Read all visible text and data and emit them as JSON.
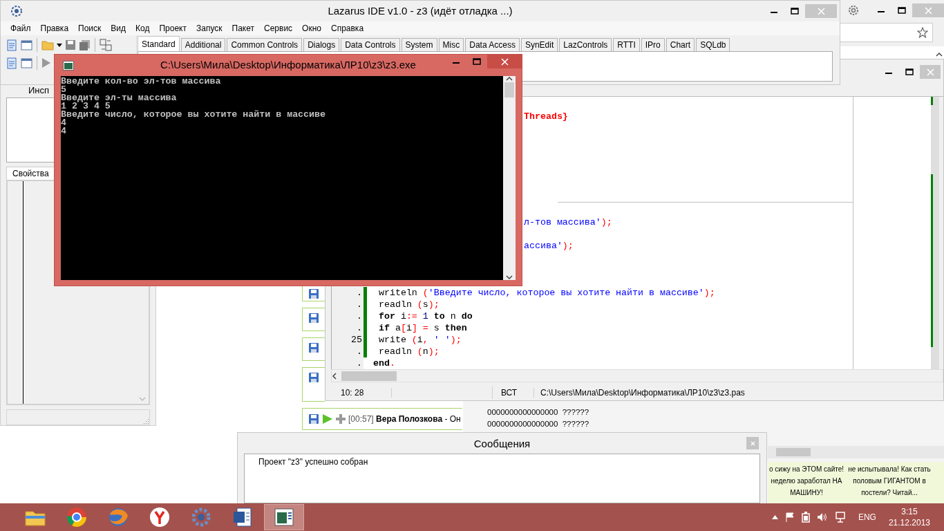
{
  "main_window": {
    "title": "Lazarus IDE v1.0 - z3 (идёт отладка ...)",
    "menu": [
      "Файл",
      "Правка",
      "Поиск",
      "Вид",
      "Код",
      "Проект",
      "Запуск",
      "Пакет",
      "Сервис",
      "Окно",
      "Справка"
    ],
    "palette_tabs": [
      {
        "label": "Standard",
        "selected": true
      },
      {
        "label": "Additional",
        "selected": false
      },
      {
        "label": "Common Controls",
        "selected": false
      },
      {
        "label": "Dialogs",
        "selected": false
      },
      {
        "label": "Data Controls",
        "selected": false
      },
      {
        "label": "System",
        "selected": false
      },
      {
        "label": "Misc",
        "selected": false
      },
      {
        "label": "Data Access",
        "selected": false
      },
      {
        "label": "SynEdit",
        "selected": false
      },
      {
        "label": "LazControls",
        "selected": false
      },
      {
        "label": "RTTI",
        "selected": false
      },
      {
        "label": "IPro",
        "selected": false
      },
      {
        "label": "Chart",
        "selected": false
      },
      {
        "label": "SQLdb",
        "selected": false
      }
    ]
  },
  "object_inspector": {
    "title": "Инсп",
    "tabs": [
      {
        "label": "Свойства",
        "selected": true
      }
    ]
  },
  "source_editor": {
    "lines": [
      {
        "kind": "clipped",
        "tokens": [
          {
            "text": "Threads}",
            "kind": "dir"
          }
        ]
      },
      {
        "kind": "covered"
      },
      {
        "kind": "covered"
      },
      {
        "kind": "covered"
      },
      {
        "kind": "covered"
      },
      {
        "kind": "covered"
      },
      {
        "kind": "covered"
      },
      {
        "kind": "covered"
      },
      {
        "kind": "covered"
      },
      {
        "kind": "clipped",
        "tokens": [
          {
            "text": "л-тов массива'",
            "kind": "str"
          },
          {
            "text": ");",
            "kind": "sym"
          }
        ]
      },
      {
        "kind": "covered"
      },
      {
        "kind": "clipped",
        "tokens": [
          {
            "text": "ассива'",
            "kind": "str"
          },
          {
            "text": ");",
            "kind": "sym"
          }
        ]
      },
      {
        "kind": "covered"
      },
      {
        "kind": "covered"
      },
      {
        "kind": "covered"
      },
      {
        "kind": "full",
        "gutter": ".",
        "modified": true,
        "tokens": [
          {
            "text": " writeln ",
            "kind": "id"
          },
          {
            "text": "(",
            "kind": "sym"
          },
          {
            "text": "'Введите число, которое вы хотите найти в массиве'",
            "kind": "str"
          },
          {
            "text": ");",
            "kind": "sym"
          }
        ]
      },
      {
        "kind": "full",
        "gutter": ".",
        "modified": true,
        "tokens": [
          {
            "text": " readln ",
            "kind": "id"
          },
          {
            "text": "(",
            "kind": "sym"
          },
          {
            "text": "s",
            "kind": "id"
          },
          {
            "text": ");",
            "kind": "sym"
          }
        ]
      },
      {
        "kind": "full",
        "gutter": ".",
        "modified": true,
        "tokens": [
          {
            "text": " for",
            "kind": "kw"
          },
          {
            "text": " i",
            "kind": "id"
          },
          {
            "text": ":=",
            "kind": "sym"
          },
          {
            "text": " 1",
            "kind": "num"
          },
          {
            "text": " to",
            "kind": "kw"
          },
          {
            "text": " n",
            "kind": "id"
          },
          {
            "text": " do",
            "kind": "kw"
          }
        ]
      },
      {
        "kind": "full",
        "gutter": ".",
        "modified": true,
        "tokens": [
          {
            "text": " if",
            "kind": "kw"
          },
          {
            "text": " a",
            "kind": "id"
          },
          {
            "text": "[",
            "kind": "sym"
          },
          {
            "text": "i",
            "kind": "id"
          },
          {
            "text": "]",
            "kind": "sym"
          },
          {
            "text": " =",
            "kind": "sym"
          },
          {
            "text": " s",
            "kind": "id"
          },
          {
            "text": " then",
            "kind": "kw"
          }
        ]
      },
      {
        "kind": "full",
        "gutter": "25",
        "modified": true,
        "tokens": [
          {
            "text": " write ",
            "kind": "id"
          },
          {
            "text": "(",
            "kind": "sym"
          },
          {
            "text": "i",
            "kind": "id"
          },
          {
            "text": ", ",
            "kind": "sym"
          },
          {
            "text": "' '",
            "kind": "str"
          },
          {
            "text": ");",
            "kind": "sym"
          }
        ]
      },
      {
        "kind": "full",
        "gutter": ".",
        "modified": true,
        "tokens": [
          {
            "text": " readln ",
            "kind": "id"
          },
          {
            "text": "(",
            "kind": "sym"
          },
          {
            "text": "n",
            "kind": "id"
          },
          {
            "text": ");",
            "kind": "sym"
          }
        ]
      },
      {
        "kind": "full",
        "gutter": ".",
        "modified": false,
        "tokens": [
          {
            "text": "end",
            "kind": "kw"
          },
          {
            "text": ".",
            "kind": "sym"
          }
        ]
      }
    ],
    "status_bar": {
      "position": "10: 28",
      "mode": "ВСТ",
      "file": "C:\\Users\\Мила\\Desktop\\Информатика\\ЛР10\\z3\\z3.pas"
    }
  },
  "console": {
    "title": "C:\\Users\\Мила\\Desktop\\Информатика\\ЛР10\\z3\\z3.exe",
    "lines": [
      "Введите кол-во эл-тов массива",
      "5",
      "Введите эл-ты массива",
      "1 2 3 4 5",
      "Введите число, которое вы хотите найти в массиве",
      "4",
      "4"
    ]
  },
  "background_page": {
    "track": {
      "time": "[00:57]",
      "artist": "Вера Полозкова",
      "title": "- Он"
    },
    "text_lines": [
      "0000000000000000  ??????",
      "0000000000000000  ??????"
    ],
    "ads": [
      "о сижу на ЭТОМ сайте! неделю заработал НА МАШИНУ!",
      "не испытывала! Как стать половым ГИГАНТОМ в постели? Читай..."
    ]
  },
  "messages": {
    "title": "Сообщения",
    "items": [
      "Проект \"z3\" успешно собран"
    ]
  },
  "taskbar": {
    "apps": [
      {
        "kind": "folder",
        "selected": false
      },
      {
        "kind": "ring",
        "selected": false
      },
      {
        "kind": "globe",
        "selected": false
      },
      {
        "kind": "yletter",
        "selected": false
      },
      {
        "kind": "gear",
        "selected": false
      },
      {
        "kind": "document",
        "selected": false
      },
      {
        "kind": "console",
        "selected": true
      }
    ],
    "language": "ENG",
    "time": "3:15",
    "date": "21.12.2013"
  }
}
